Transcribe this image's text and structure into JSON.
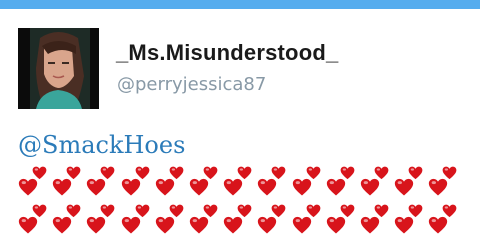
{
  "tweet": {
    "display_name": "_Ms.Misunderstood_",
    "handle": "@perryjessica87",
    "mention": "@SmackHoes",
    "avatar_icon": "profile-photo",
    "heart_icon": "red-heart-icon",
    "heart_color": "#d8141b",
    "heart_rows": 2,
    "heart_pairs_per_row": 13
  },
  "colors": {
    "accent_bar": "#55acee",
    "mention_link": "#2b7bb9",
    "handle_text": "#8899a6"
  }
}
